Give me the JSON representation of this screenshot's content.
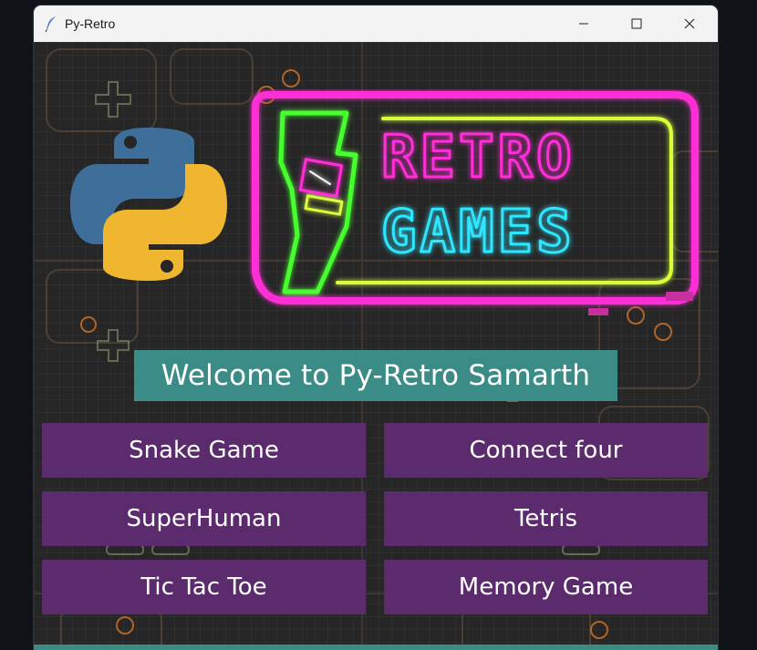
{
  "window": {
    "title": "Py-Retro",
    "app_icon": "feather-icon",
    "controls": [
      "minimize-icon",
      "maximize-icon",
      "close-icon"
    ]
  },
  "banner": {
    "logo_left": "python-logo",
    "sign_line1": "RETRO",
    "sign_line2": "GAMES"
  },
  "welcome_text": "Welcome to Py-Retro Samarth",
  "games": [
    {
      "label": "Snake Game"
    },
    {
      "label": "Connect four"
    },
    {
      "label": "SuperHuman"
    },
    {
      "label": "Tetris"
    },
    {
      "label": "Tic Tac Toe"
    },
    {
      "label": "Memory Game"
    }
  ],
  "colors": {
    "button_bg": "#5c2b6e",
    "welcome_bg": "#3b8c86",
    "neon_pink": "#ff2fd6",
    "neon_cyan": "#2fe6ff",
    "neon_green": "#47ff2f",
    "neon_yellow": "#d8ff3a"
  }
}
